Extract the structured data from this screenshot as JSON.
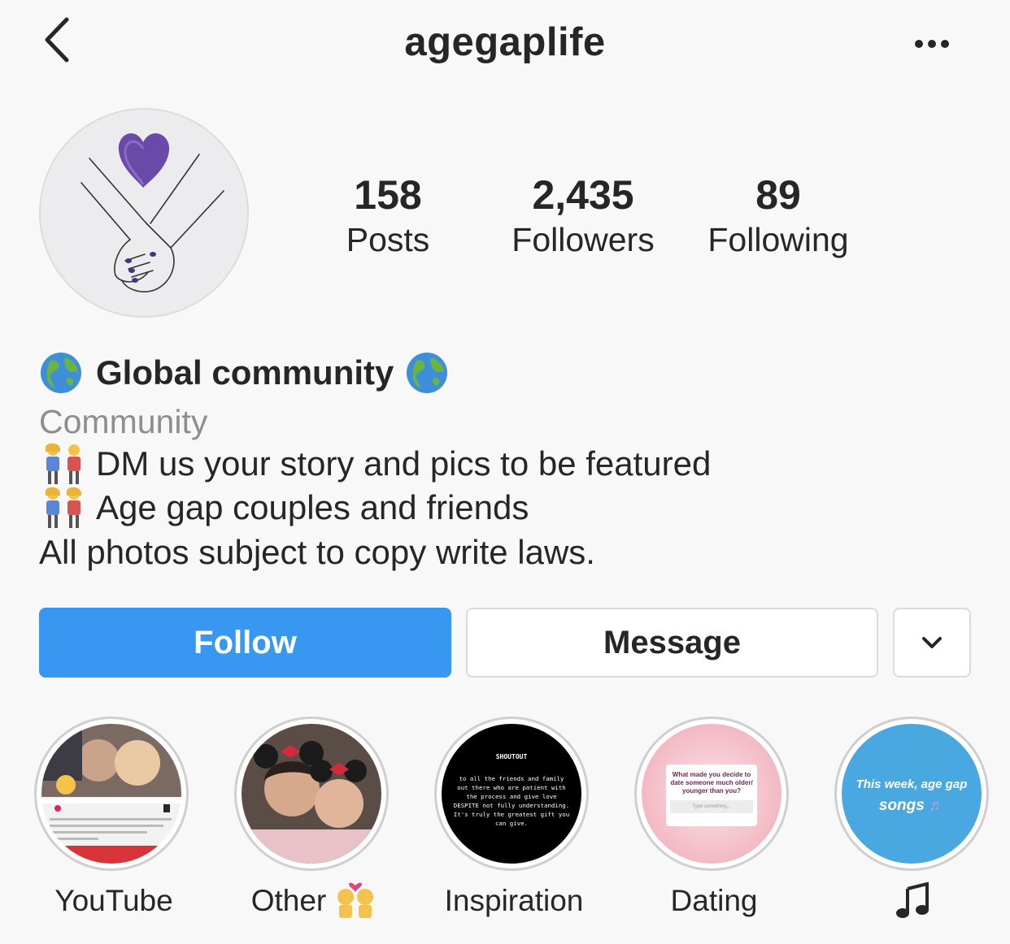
{
  "header": {
    "username": "agegaplife",
    "back_icon": "chevron-left-icon",
    "more_icon": "ellipsis-icon"
  },
  "stats": [
    {
      "count": "158",
      "label": "Posts"
    },
    {
      "count": "2,435",
      "label": "Followers"
    },
    {
      "count": "89",
      "label": "Following"
    }
  ],
  "bio": {
    "name": "Global community",
    "category": "Community",
    "line1": "DM us your story and pics to be featured",
    "line2": "Age gap couples and friends",
    "line3": "All photos subject to copy write laws."
  },
  "actions": {
    "follow_label": "Follow",
    "message_label": "Message",
    "dropdown_icon": "chevron-down-icon"
  },
  "highlights": [
    {
      "label": "YouTube"
    },
    {
      "label": "Other"
    },
    {
      "label": "Inspiration",
      "shoutout_title": "SHOUTOUT",
      "text": "to all the friends and family out there who are patient with the process and give love DESPITE not fully understanding. It's truly the greatest gift you can give."
    },
    {
      "label": "Dating",
      "question": "What made you decide to date someone much older/ younger than you?",
      "placeholder": "Type something..."
    },
    {
      "label": "",
      "text_a": "This week, age gap",
      "text_b": "songs"
    }
  ],
  "colors": {
    "follow_blue": "#3897f0",
    "text_primary": "#262626",
    "text_secondary": "#8e8e8e",
    "background": "#f8f8f8",
    "border": "#dbdbdb"
  }
}
